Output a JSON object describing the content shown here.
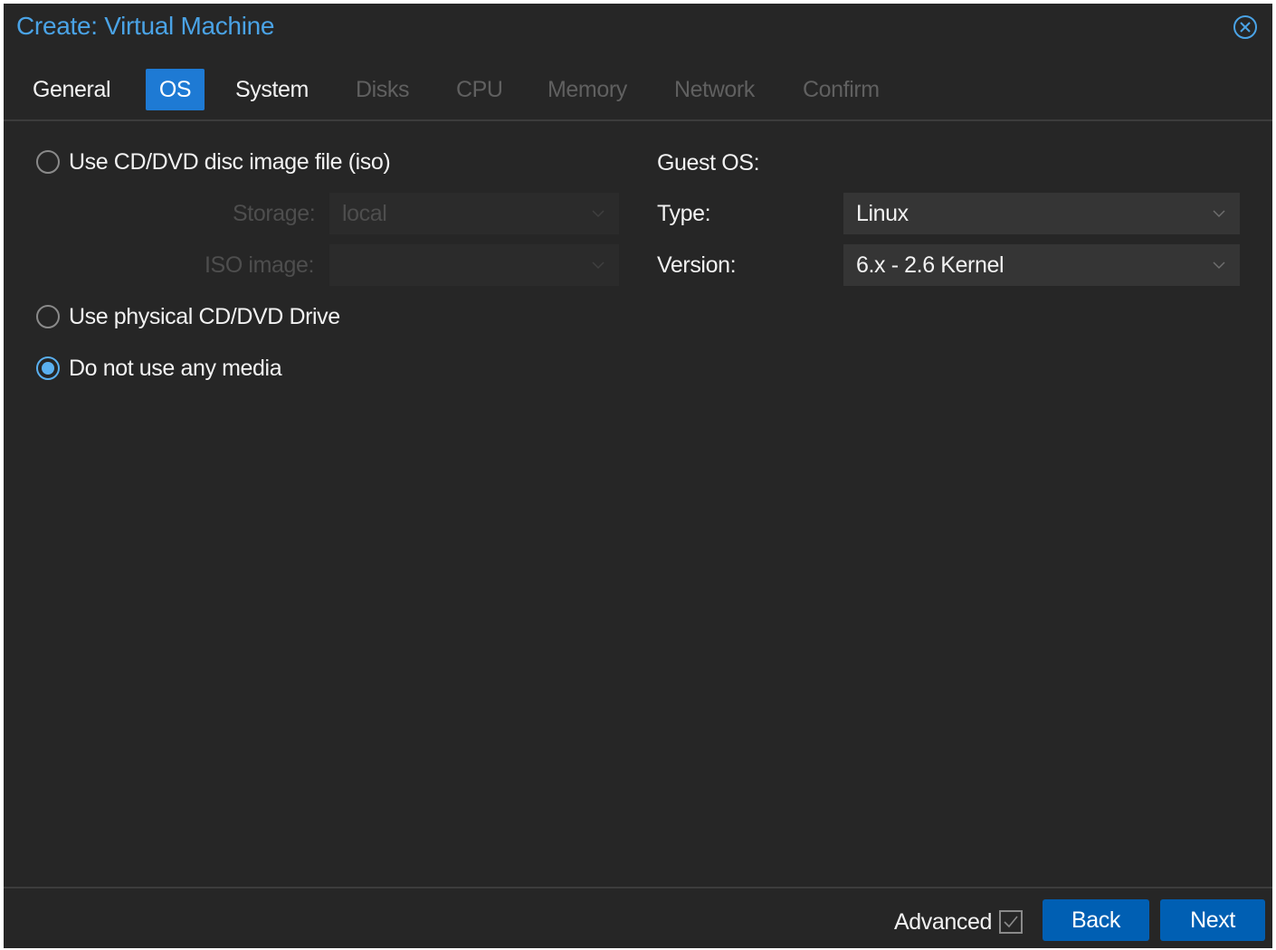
{
  "window": {
    "title": "Create: Virtual Machine",
    "close_icon": "close-circle-icon"
  },
  "tabs": [
    {
      "label": "General",
      "state": "enabled"
    },
    {
      "label": "OS",
      "state": "active"
    },
    {
      "label": "System",
      "state": "enabled"
    },
    {
      "label": "Disks",
      "state": "disabled"
    },
    {
      "label": "CPU",
      "state": "disabled"
    },
    {
      "label": "Memory",
      "state": "disabled"
    },
    {
      "label": "Network",
      "state": "disabled"
    },
    {
      "label": "Confirm",
      "state": "disabled"
    }
  ],
  "media": {
    "iso_option": "Use CD/DVD disc image file (iso)",
    "storage_label": "Storage:",
    "storage_value": "local",
    "iso_image_label": "ISO image:",
    "iso_image_value": "",
    "physical_option": "Use physical CD/DVD Drive",
    "none_option": "Do not use any media",
    "selected": "none"
  },
  "guest_os": {
    "section_label": "Guest OS:",
    "type_label": "Type:",
    "type_value": "Linux",
    "version_label": "Version:",
    "version_value": "6.x - 2.6 Kernel"
  },
  "footer": {
    "advanced_label": "Advanced",
    "advanced_checked": true,
    "back_label": "Back",
    "next_label": "Next"
  },
  "colors": {
    "accent": "#4aa3e6",
    "active_tab": "#1e7ad4",
    "button": "#005fb3",
    "background": "#262626"
  }
}
